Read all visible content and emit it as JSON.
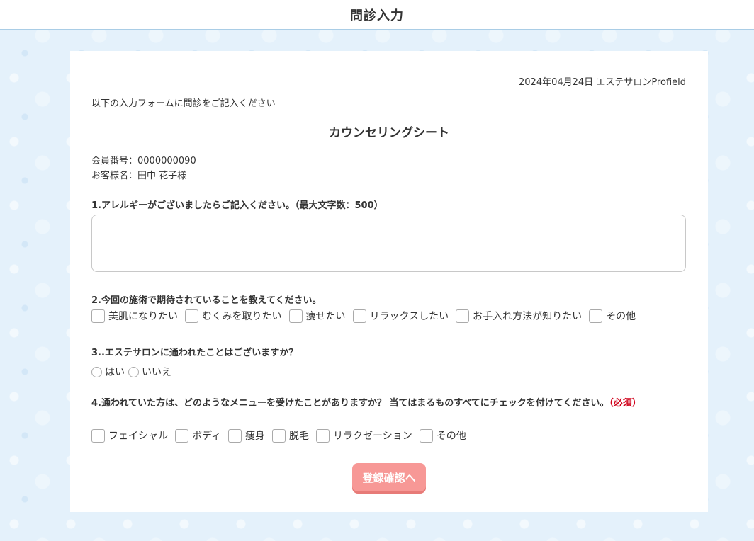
{
  "header": {
    "title": "問診入力"
  },
  "card": {
    "date_line": "2024年04月24日 エステサロンProfield",
    "intro": "以下の入力フォームに問診をご記入ください",
    "sheet_title": "カウンセリングシート",
    "member_number": "会員番号：0000000090",
    "customer_name": "お客様名：田中 花子様"
  },
  "q1": {
    "label": "1.アレルギーがございましたらご記入ください。（最大文字数：500）",
    "value": "",
    "placeholder": ""
  },
  "q2": {
    "label": "2.今回の施術で期待されていることを教えてください。",
    "options": [
      "美肌になりたい",
      "むくみを取りたい",
      "痩せたい",
      "リラックスしたい",
      "お手入れ方法が知りたい",
      "その他"
    ]
  },
  "q3": {
    "label": "3..エステサロンに通われたことはございますか？",
    "options": [
      "はい",
      "いいえ"
    ]
  },
  "q4": {
    "label": "4.通われていた方は、どのようなメニューを受けたことがありますか？ 当てはまるものすべてにチェックを付けてください。",
    "required": "（必須）",
    "options": [
      "フェイシャル",
      "ボディ",
      "痩身",
      "脱毛",
      "リラクゼーション",
      "その他"
    ]
  },
  "submit": {
    "label": "登録確認へ"
  },
  "colors": {
    "background": "#e4f1fb",
    "button": "#f79896",
    "required": "#d0021b"
  }
}
